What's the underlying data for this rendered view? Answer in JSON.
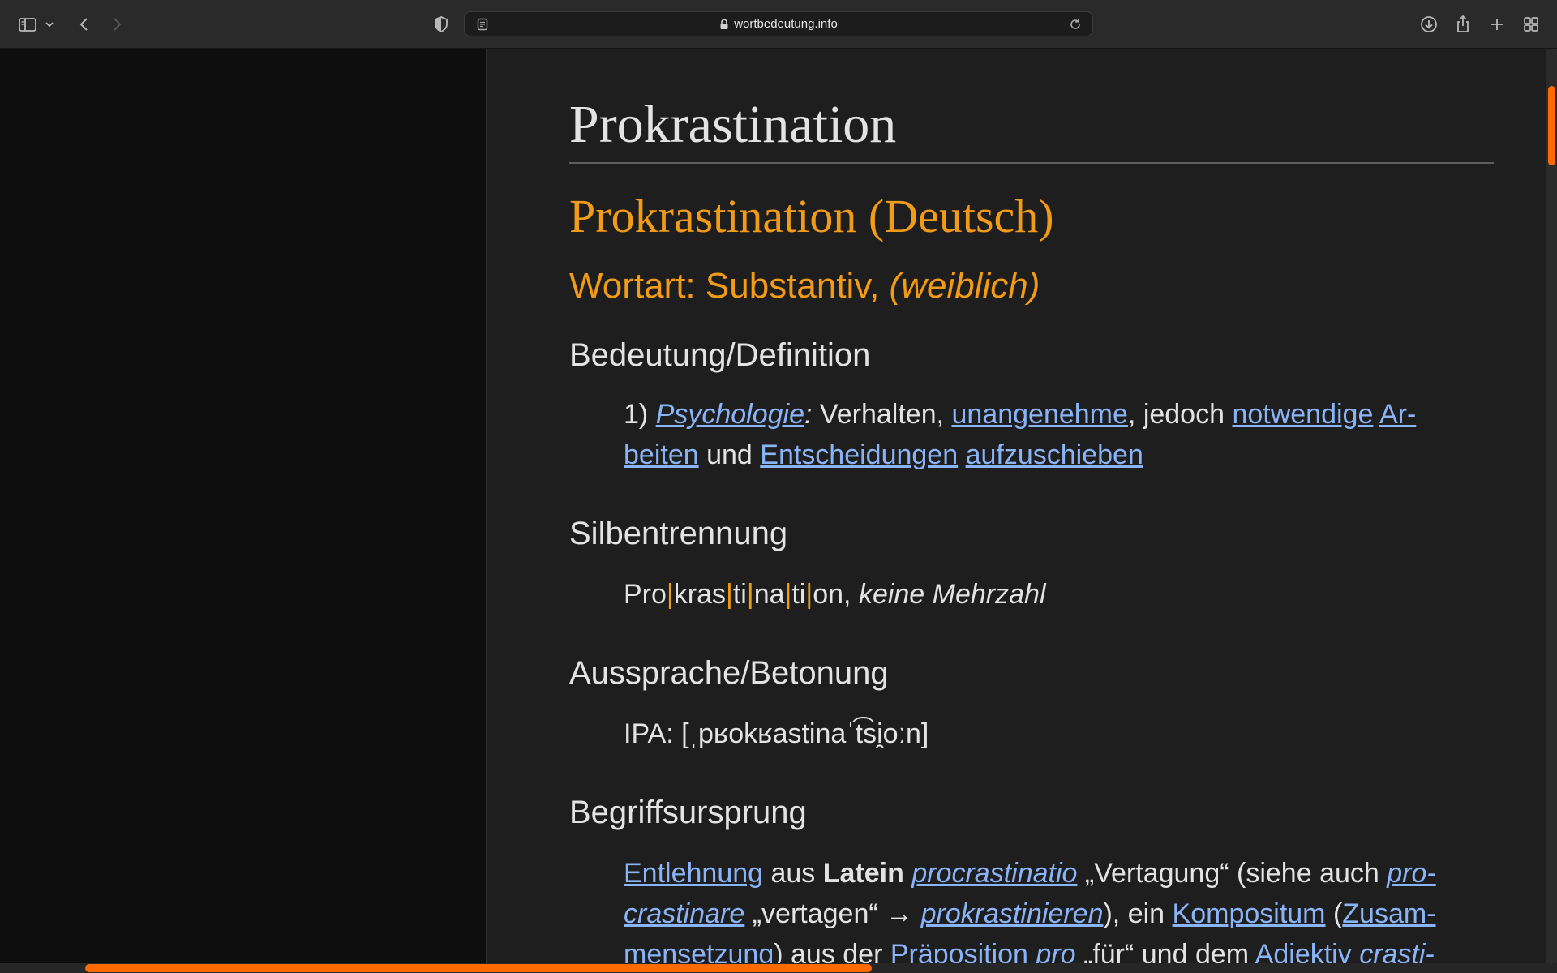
{
  "browser": {
    "url": "wortbedeutung.info"
  },
  "article": {
    "title": "Prokrastination",
    "language_heading": "Prokrastination (Deutsch)",
    "pos_prefix": "Wortart: Substantiv, ",
    "pos_gender": "(weiblich)",
    "definition": {
      "heading": "Bedeutung/Definition",
      "number": "1) ",
      "field": "Psychologie",
      "colon": ":",
      "t1": " Verhalten, ",
      "link1": "unangenehme",
      "t2": ", jedoch ",
      "link2": "notwendige",
      "t3": " ",
      "link3a": "Ar-",
      "link3b": "beiten",
      "t4": " und ",
      "link4": "Entscheidungen",
      "t5": " ",
      "link5": "aufzuschieben"
    },
    "syllables": {
      "heading": "Silbentrennung",
      "parts": [
        "Pro",
        "kras",
        "ti",
        "na",
        "ti",
        "on"
      ],
      "separator": "|",
      "suffix": ", ",
      "plural": "keine Mehrzahl"
    },
    "pronunciation": {
      "heading": "Aussprache/Betonung",
      "ipa": "IPA: [ˌpʁokʁastinaˈt͡si̯oːn]"
    },
    "etymology": {
      "heading": "Begriffsursprung",
      "link1": "Entlehnung",
      "t1": " aus ",
      "bold1": "Latein",
      "t2": " ",
      "link2": "procrastinatio",
      "t3": " „Vertagung“ (siehe auch ",
      "link3a": "pro-",
      "link3b": "crastinare",
      "t4": " „vertagen“ → ",
      "link4": "prokrastinieren",
      "t5": "), ein ",
      "link5": "Kompositum",
      "t6": " (",
      "link6a": "Zusam-",
      "link6b": "mensetzung",
      "t7": ") aus der ",
      "link7": "Präposition",
      "t8": " ",
      "link8": "pro",
      "t9": " „für“ und dem ",
      "link9": "Adjektiv",
      "t10": " ",
      "link10": "crasti-"
    }
  },
  "scroll": {
    "vertical_position": 0.04,
    "horizontal_position": 0.05
  },
  "colors": {
    "accent": "#f29b17",
    "link": "#8ab4f8",
    "scroll_thumb": "#ff6b00"
  }
}
